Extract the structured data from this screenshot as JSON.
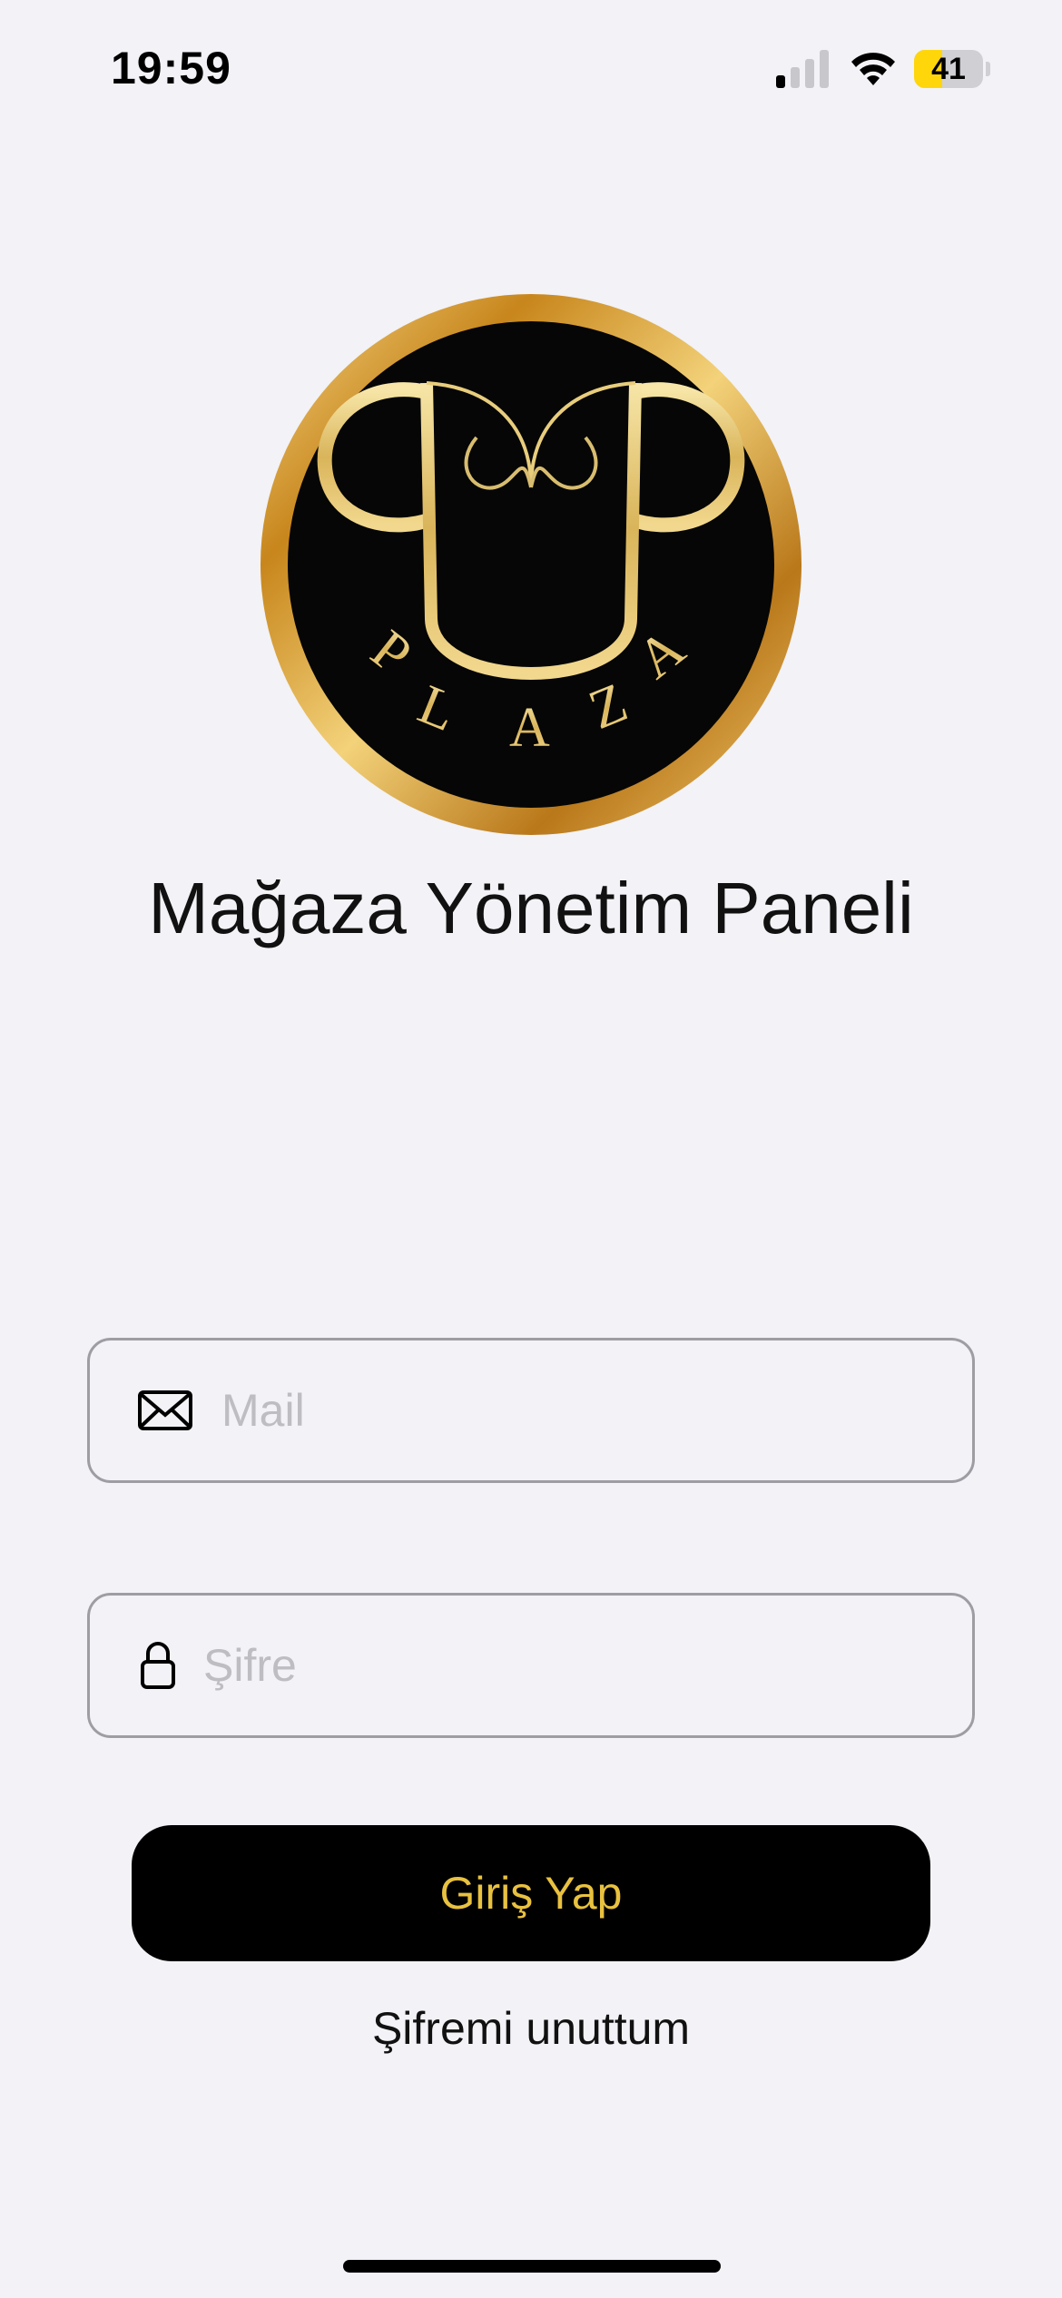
{
  "status_bar": {
    "time": "19:59",
    "battery_percent": "41",
    "battery_level": 0.41,
    "signal_bars_active": 1,
    "signal_bars_total": 4,
    "icons": [
      "cellular-signal-icon",
      "wifi-icon",
      "battery-icon"
    ]
  },
  "logo": {
    "lettering": "PLAZA"
  },
  "page": {
    "title": "Mağaza Yönetim Paneli"
  },
  "form": {
    "mail": {
      "placeholder": "Mail",
      "value": "",
      "icon": "envelope-icon"
    },
    "password": {
      "placeholder": "Şifre",
      "value": "",
      "icon": "lock-icon"
    },
    "login_label": "Giriş Yap",
    "forgot_label": "Şifremi unuttum"
  },
  "colors": {
    "background": "#f2f2f7",
    "button_bg": "#000000",
    "button_text": "#e8c13f",
    "logo_gold": "#d9a43a",
    "battery_yellow": "#ffd60a"
  }
}
